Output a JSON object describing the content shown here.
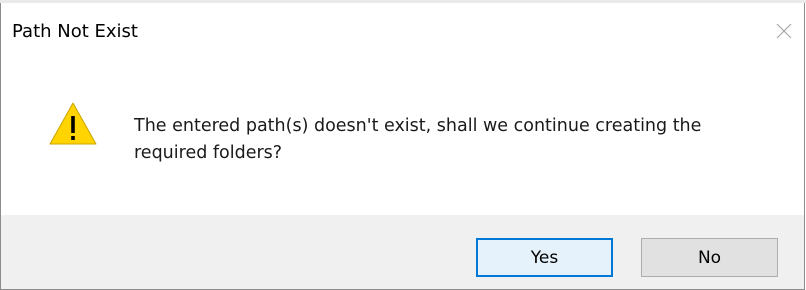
{
  "dialog": {
    "title": "Path Not Exist",
    "close_icon": "close-icon",
    "warning_icon": "warning-icon",
    "message": "The entered path(s) doesn't exist, shall we continue creating the required folders?",
    "buttons": {
      "yes_label": "Yes",
      "no_label": "No"
    }
  },
  "colors": {
    "default_button_border": "#0078d7",
    "default_button_fill": "#e5f1fb",
    "button_fill": "#e1e1e1",
    "button_bar": "#f0f0f0",
    "warning_fill": "#ffd400"
  }
}
